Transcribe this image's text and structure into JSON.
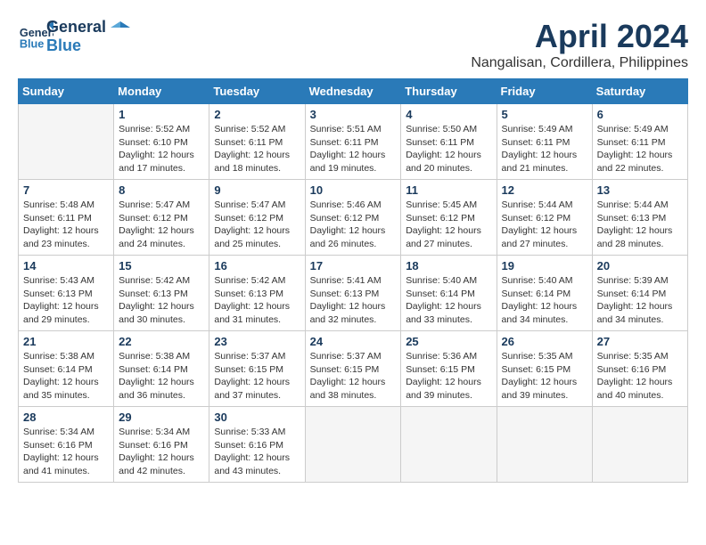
{
  "header": {
    "logo_line1": "General",
    "logo_line2": "Blue",
    "month": "April 2024",
    "location": "Nangalisan, Cordillera, Philippines"
  },
  "weekdays": [
    "Sunday",
    "Monday",
    "Tuesday",
    "Wednesday",
    "Thursday",
    "Friday",
    "Saturday"
  ],
  "weeks": [
    [
      {
        "day": "",
        "info": ""
      },
      {
        "day": "1",
        "info": "Sunrise: 5:52 AM\nSunset: 6:10 PM\nDaylight: 12 hours\nand 17 minutes."
      },
      {
        "day": "2",
        "info": "Sunrise: 5:52 AM\nSunset: 6:11 PM\nDaylight: 12 hours\nand 18 minutes."
      },
      {
        "day": "3",
        "info": "Sunrise: 5:51 AM\nSunset: 6:11 PM\nDaylight: 12 hours\nand 19 minutes."
      },
      {
        "day": "4",
        "info": "Sunrise: 5:50 AM\nSunset: 6:11 PM\nDaylight: 12 hours\nand 20 minutes."
      },
      {
        "day": "5",
        "info": "Sunrise: 5:49 AM\nSunset: 6:11 PM\nDaylight: 12 hours\nand 21 minutes."
      },
      {
        "day": "6",
        "info": "Sunrise: 5:49 AM\nSunset: 6:11 PM\nDaylight: 12 hours\nand 22 minutes."
      }
    ],
    [
      {
        "day": "7",
        "info": "Sunrise: 5:48 AM\nSunset: 6:11 PM\nDaylight: 12 hours\nand 23 minutes."
      },
      {
        "day": "8",
        "info": "Sunrise: 5:47 AM\nSunset: 6:12 PM\nDaylight: 12 hours\nand 24 minutes."
      },
      {
        "day": "9",
        "info": "Sunrise: 5:47 AM\nSunset: 6:12 PM\nDaylight: 12 hours\nand 25 minutes."
      },
      {
        "day": "10",
        "info": "Sunrise: 5:46 AM\nSunset: 6:12 PM\nDaylight: 12 hours\nand 26 minutes."
      },
      {
        "day": "11",
        "info": "Sunrise: 5:45 AM\nSunset: 6:12 PM\nDaylight: 12 hours\nand 27 minutes."
      },
      {
        "day": "12",
        "info": "Sunrise: 5:44 AM\nSunset: 6:12 PM\nDaylight: 12 hours\nand 27 minutes."
      },
      {
        "day": "13",
        "info": "Sunrise: 5:44 AM\nSunset: 6:13 PM\nDaylight: 12 hours\nand 28 minutes."
      }
    ],
    [
      {
        "day": "14",
        "info": "Sunrise: 5:43 AM\nSunset: 6:13 PM\nDaylight: 12 hours\nand 29 minutes."
      },
      {
        "day": "15",
        "info": "Sunrise: 5:42 AM\nSunset: 6:13 PM\nDaylight: 12 hours\nand 30 minutes."
      },
      {
        "day": "16",
        "info": "Sunrise: 5:42 AM\nSunset: 6:13 PM\nDaylight: 12 hours\nand 31 minutes."
      },
      {
        "day": "17",
        "info": "Sunrise: 5:41 AM\nSunset: 6:13 PM\nDaylight: 12 hours\nand 32 minutes."
      },
      {
        "day": "18",
        "info": "Sunrise: 5:40 AM\nSunset: 6:14 PM\nDaylight: 12 hours\nand 33 minutes."
      },
      {
        "day": "19",
        "info": "Sunrise: 5:40 AM\nSunset: 6:14 PM\nDaylight: 12 hours\nand 34 minutes."
      },
      {
        "day": "20",
        "info": "Sunrise: 5:39 AM\nSunset: 6:14 PM\nDaylight: 12 hours\nand 34 minutes."
      }
    ],
    [
      {
        "day": "21",
        "info": "Sunrise: 5:38 AM\nSunset: 6:14 PM\nDaylight: 12 hours\nand 35 minutes."
      },
      {
        "day": "22",
        "info": "Sunrise: 5:38 AM\nSunset: 6:14 PM\nDaylight: 12 hours\nand 36 minutes."
      },
      {
        "day": "23",
        "info": "Sunrise: 5:37 AM\nSunset: 6:15 PM\nDaylight: 12 hours\nand 37 minutes."
      },
      {
        "day": "24",
        "info": "Sunrise: 5:37 AM\nSunset: 6:15 PM\nDaylight: 12 hours\nand 38 minutes."
      },
      {
        "day": "25",
        "info": "Sunrise: 5:36 AM\nSunset: 6:15 PM\nDaylight: 12 hours\nand 39 minutes."
      },
      {
        "day": "26",
        "info": "Sunrise: 5:35 AM\nSunset: 6:15 PM\nDaylight: 12 hours\nand 39 minutes."
      },
      {
        "day": "27",
        "info": "Sunrise: 5:35 AM\nSunset: 6:16 PM\nDaylight: 12 hours\nand 40 minutes."
      }
    ],
    [
      {
        "day": "28",
        "info": "Sunrise: 5:34 AM\nSunset: 6:16 PM\nDaylight: 12 hours\nand 41 minutes."
      },
      {
        "day": "29",
        "info": "Sunrise: 5:34 AM\nSunset: 6:16 PM\nDaylight: 12 hours\nand 42 minutes."
      },
      {
        "day": "30",
        "info": "Sunrise: 5:33 AM\nSunset: 6:16 PM\nDaylight: 12 hours\nand 43 minutes."
      },
      {
        "day": "",
        "info": ""
      },
      {
        "day": "",
        "info": ""
      },
      {
        "day": "",
        "info": ""
      },
      {
        "day": "",
        "info": ""
      }
    ]
  ]
}
